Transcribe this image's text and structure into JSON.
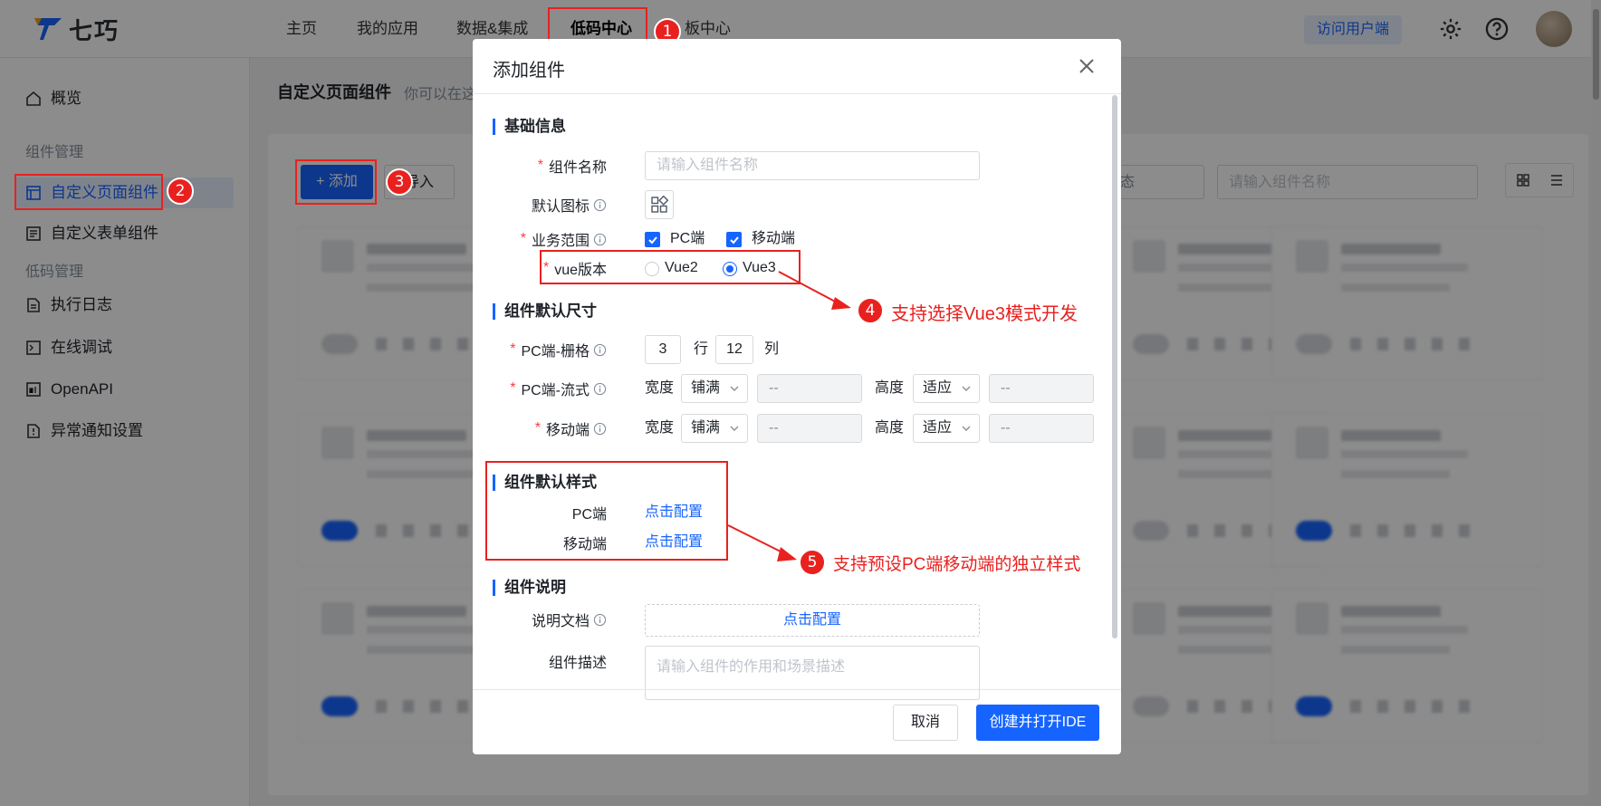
{
  "app": {
    "logo_text": "七巧",
    "brand_color": "#1664ff",
    "annotation_color": "#e8211f"
  },
  "nav": {
    "items": [
      {
        "label": "主页"
      },
      {
        "label": "我的应用"
      },
      {
        "label": "数据&集成"
      },
      {
        "label": "低码中心",
        "active": true
      },
      {
        "label": "板中心"
      }
    ],
    "visit_button": "访问用户端",
    "icons": [
      "gear-icon",
      "help-icon",
      "avatar"
    ]
  },
  "sidebar": {
    "overview": "概览",
    "group_component": "组件管理",
    "custom_page": "自定义页面组件",
    "custom_form": "自定义表单组件",
    "group_lowcode": "低码管理",
    "exec_log": "执行日志",
    "online_debug": "在线调试",
    "openapi": "OpenAPI",
    "alert_settings": "异常通知设置"
  },
  "content": {
    "title": "自定义页面组件",
    "subtitle": "你可以在这",
    "add_button": "+ 添加",
    "import_button": "导入",
    "status_placeholder": "态",
    "search_placeholder": "请输入组件名称"
  },
  "modal": {
    "title": "添加组件",
    "sections": {
      "basic": "基础信息",
      "size": "组件默认尺寸",
      "style": "组件默认样式",
      "desc": "组件说明"
    },
    "fields": {
      "name_label": "组件名称",
      "name_placeholder": "请输入组件名称",
      "icon_label": "默认图标",
      "scope_label": "业务范围",
      "scope_pc": "PC端",
      "scope_mobile": "移动端",
      "vue_label": "vue版本",
      "vue2": "Vue2",
      "vue3": "Vue3",
      "pc_grid_label": "PC端-栅格",
      "pc_grid_rows": "3",
      "rows_unit": "行",
      "pc_grid_cols": "12",
      "cols_unit": "列",
      "pc_flow_label": "PC端-流式",
      "mobile_label": "移动端",
      "width_label": "宽度",
      "height_label": "高度",
      "width_value": "铺满",
      "height_value": "适应",
      "dash": "--",
      "style_pc": "PC端",
      "style_mobile": "移动端",
      "config_link": "点击配置",
      "doc_label": "说明文档",
      "doc_button": "点击配置",
      "describe_label": "组件描述",
      "describe_placeholder": "请输入组件的作用和场景描述"
    },
    "cancel": "取消",
    "submit": "创建并打开IDE"
  },
  "annotations": {
    "b1": "1",
    "b2": "2",
    "b3": "3",
    "b4": "4",
    "b5": "5",
    "callout4": "支持选择Vue3模式开发",
    "callout5": "支持预设PC端移动端的独立样式"
  }
}
